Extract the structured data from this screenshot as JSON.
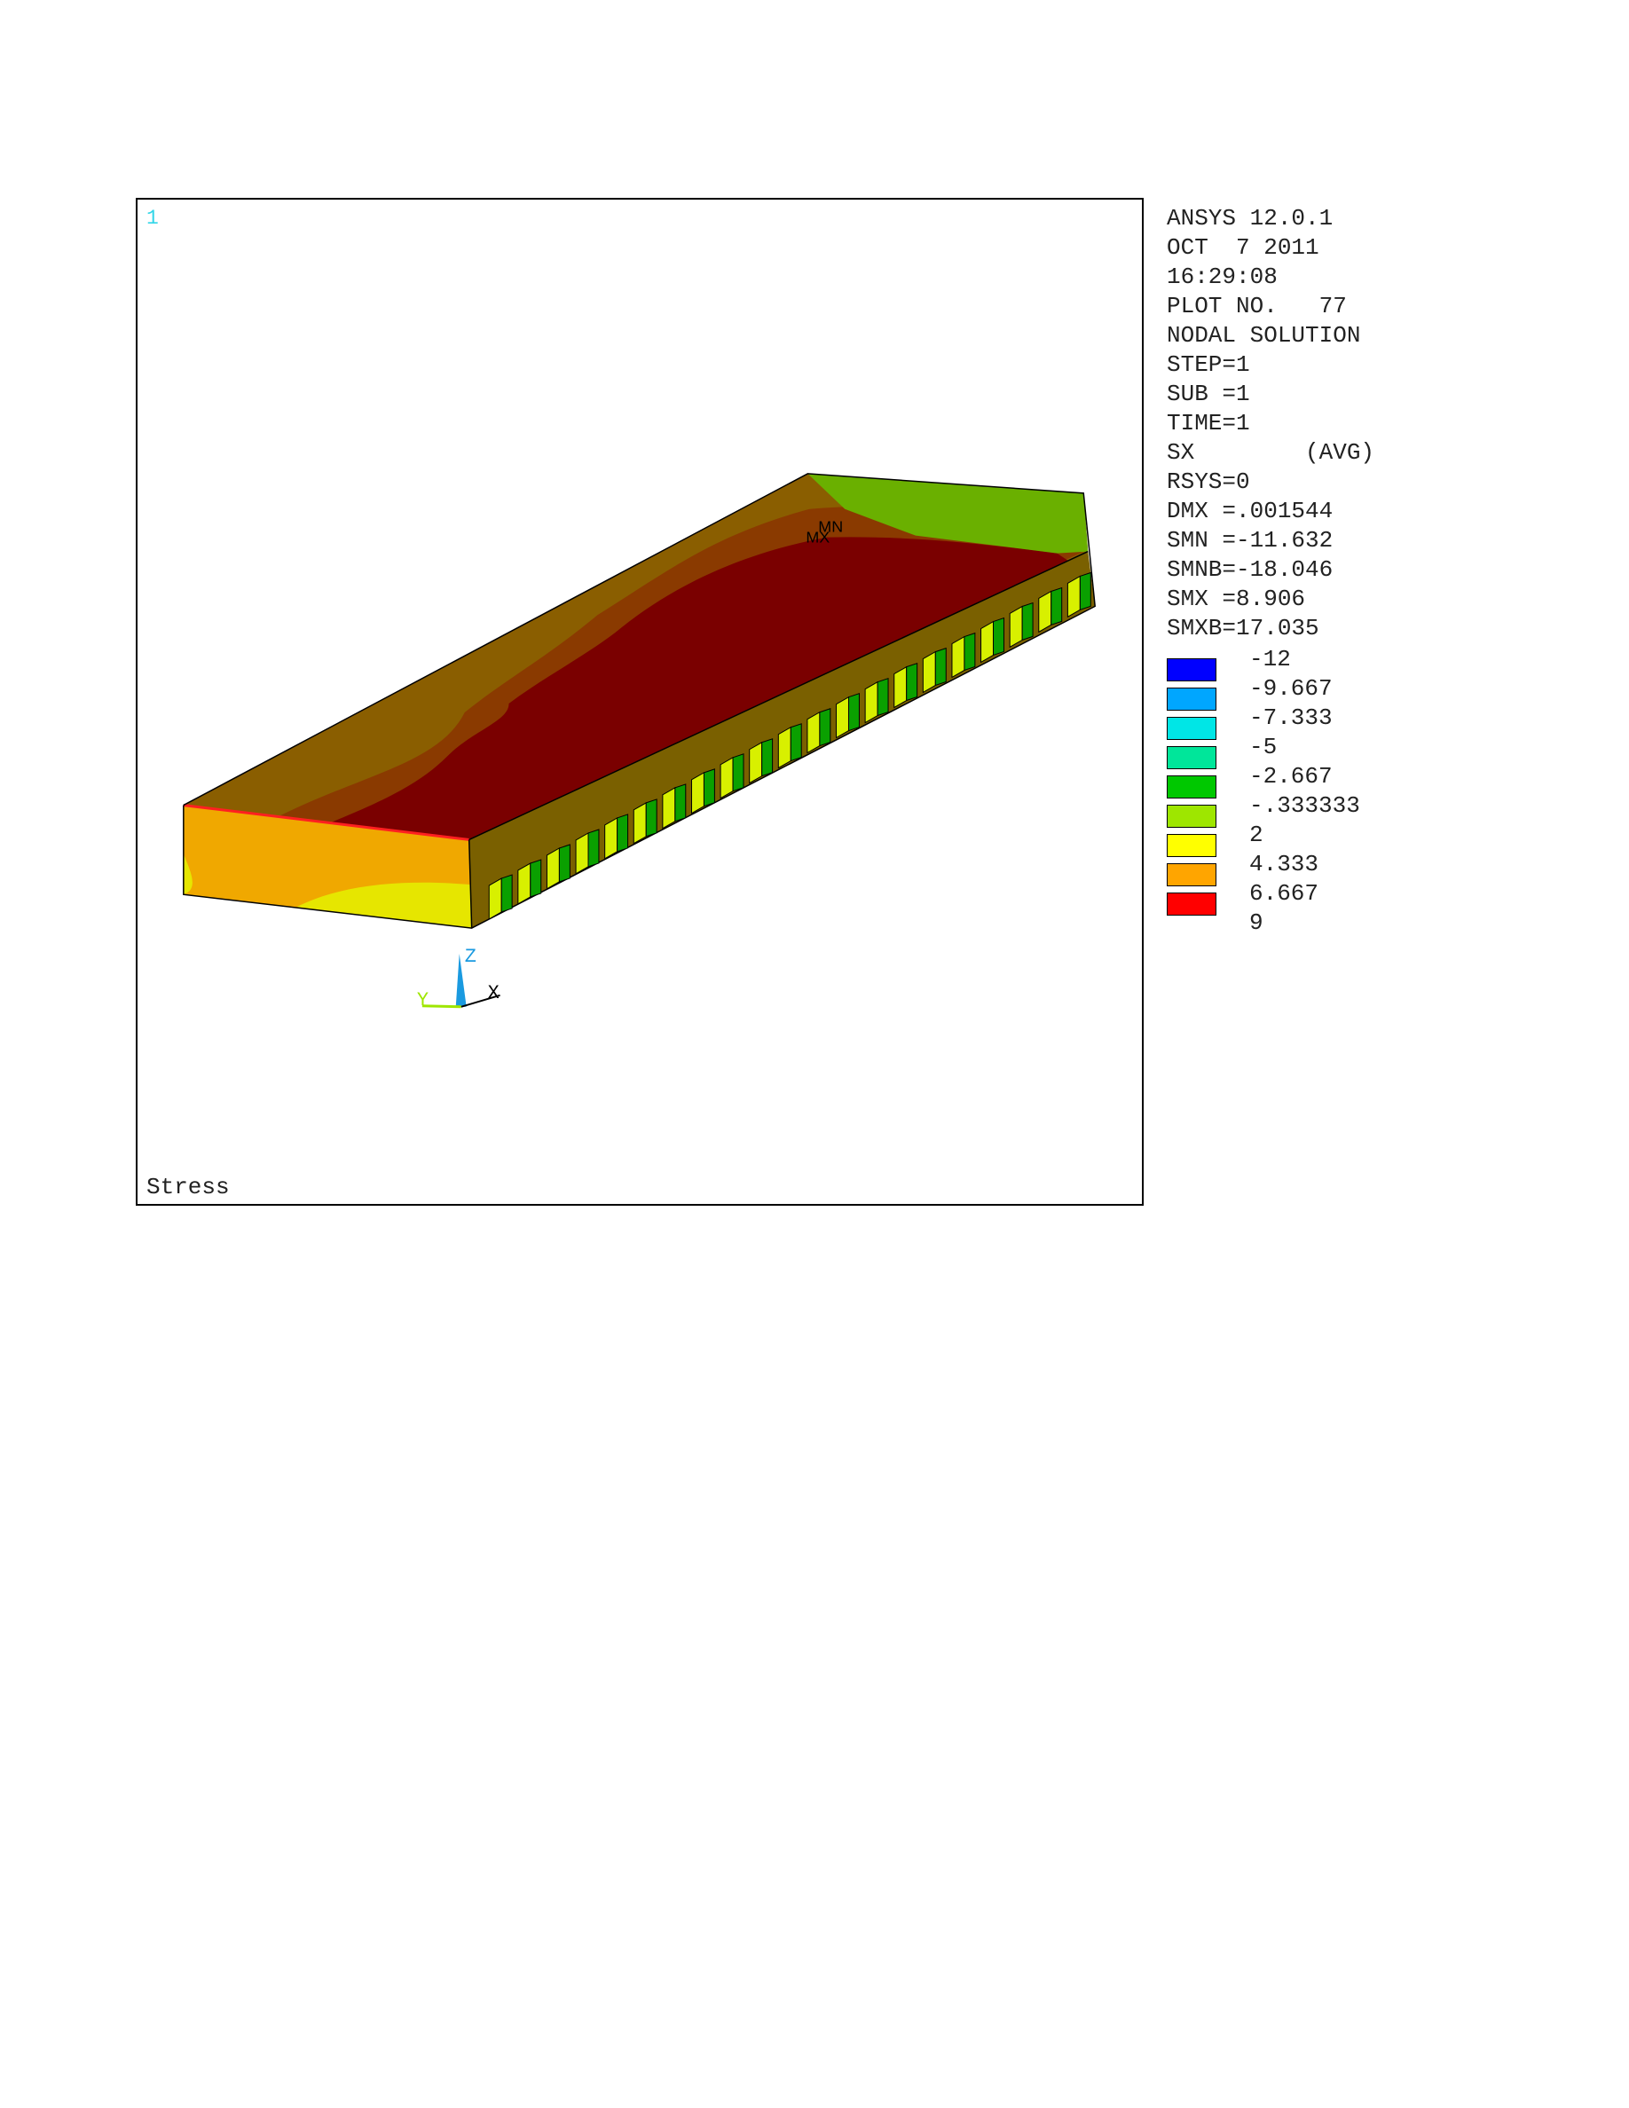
{
  "window_number": "1",
  "caption": "Stress",
  "info": [
    "ANSYS 12.0.1",
    "OCT  7 2011",
    "16:29:08",
    "PLOT NO.   77",
    "NODAL SOLUTION",
    "STEP=1",
    "SUB =1",
    "TIME=1",
    "SX        (AVG)",
    "RSYS=0",
    "DMX =.001544",
    "SMN =-11.632",
    "SMNB=-18.046",
    "SMX =8.906",
    "SMXB=17.035"
  ],
  "legend": {
    "labels": [
      "-12",
      "-9.667",
      "-7.333",
      "-5",
      "-2.667",
      "-.333333",
      "2",
      "4.333",
      "6.667",
      "9"
    ],
    "colors": [
      "#0000ff",
      "#00a6ff",
      "#00e6e6",
      "#00e69a",
      "#00c800",
      "#9ee600",
      "#ffff00",
      "#ffa500",
      "#ff0000"
    ]
  },
  "model": {
    "marker_min": "MN",
    "marker_max": "MX",
    "colors": {
      "top_core": "#7a0000",
      "top_mid": "#8a3a00",
      "top_edge": "#8a5e00",
      "front": "#f0a800",
      "front_low": "#e6e600",
      "right_dark": "#7a6000",
      "end_green": "#6ab000",
      "tooth_light": "#d8f000",
      "tooth_dark": "#0aa000"
    }
  },
  "triad": {
    "z_label": "Z",
    "x_label": "X",
    "y_label": "Y"
  }
}
